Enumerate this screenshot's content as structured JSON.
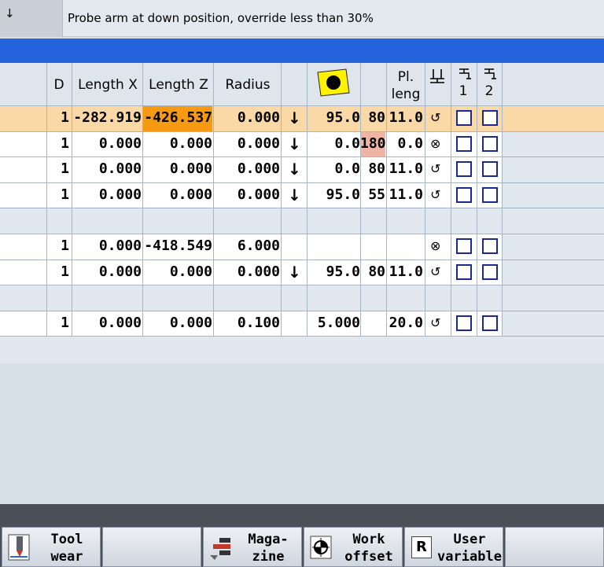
{
  "status": {
    "alarm_icon": "↓",
    "message": "Probe arm at down position, override less than 30%"
  },
  "table": {
    "headers": {
      "d": "D",
      "length_x": "Length X",
      "length_z": "Length Z",
      "radius": "Radius",
      "insert_icon": "insert-shape-icon",
      "pl_leng_1": "Pl.",
      "pl_leng_2": "leng",
      "spindle_icon": "spindle-icon",
      "coolant1_num": "1",
      "coolant2_num": "2"
    },
    "rows": [
      {
        "d": "1",
        "lx": "-282.919",
        "lz": "-426.537",
        "radius": "0.000",
        "dir": "↓",
        "angle": "95.0",
        "ang2": "80",
        "pl": "11.0",
        "spindle": "↺",
        "highlight": true
      },
      {
        "d": "1",
        "lx": "0.000",
        "lz": "0.000",
        "radius": "0.000",
        "dir": "↓",
        "angle": "0.0",
        "ang2": "180",
        "pl": "0.0",
        "spindle": "⊗",
        "highlight": false
      },
      {
        "d": "1",
        "lx": "0.000",
        "lz": "0.000",
        "radius": "0.000",
        "dir": "↓",
        "angle": "0.0",
        "ang2": "80",
        "pl": "11.0",
        "spindle": "↺",
        "highlight": false
      },
      {
        "d": "1",
        "lx": "0.000",
        "lz": "0.000",
        "radius": "0.000",
        "dir": "↓",
        "angle": "95.0",
        "ang2": "55",
        "pl": "11.0",
        "spindle": "↺",
        "highlight": false
      },
      {
        "d": "",
        "lx": "",
        "lz": "",
        "radius": "",
        "dir": "",
        "angle": "",
        "ang2": "",
        "pl": "",
        "spindle": "",
        "highlight": false
      },
      {
        "d": "1",
        "lx": "0.000",
        "lz": "-418.549",
        "radius": "6.000",
        "dir": "",
        "angle": "",
        "ang2": "",
        "pl": "",
        "spindle": "⊗",
        "highlight": false
      },
      {
        "d": "1",
        "lx": "0.000",
        "lz": "0.000",
        "radius": "0.000",
        "dir": "↓",
        "angle": "95.0",
        "ang2": "80",
        "pl": "11.0",
        "spindle": "↺",
        "highlight": false
      },
      {
        "d": "",
        "lx": "",
        "lz": "",
        "radius": "",
        "dir": "",
        "angle": "",
        "ang2": "",
        "pl": "",
        "spindle": "",
        "highlight": false
      },
      {
        "d": "1",
        "lx": "0.000",
        "lz": "0.000",
        "radius": "0.100",
        "dir": "",
        "angle": "5.000",
        "ang2": "",
        "pl": "20.0",
        "spindle": "↺",
        "highlight": false
      }
    ]
  },
  "softkeys": {
    "tool_wear_1": "Tool",
    "tool_wear_2": "wear",
    "magazine_1": "Maga-",
    "magazine_2": "zine",
    "work_offset_1": "Work",
    "work_offset_2": "offset",
    "user_variable_1": "User",
    "user_variable_2": "variable",
    "user_variable_icon_letter": "R"
  },
  "colors": {
    "highlight_row": "#fad9a6",
    "highlight_cell": "#f79a12",
    "warn_cell": "#f0b4a4",
    "accent_blue": "#2463dc"
  }
}
